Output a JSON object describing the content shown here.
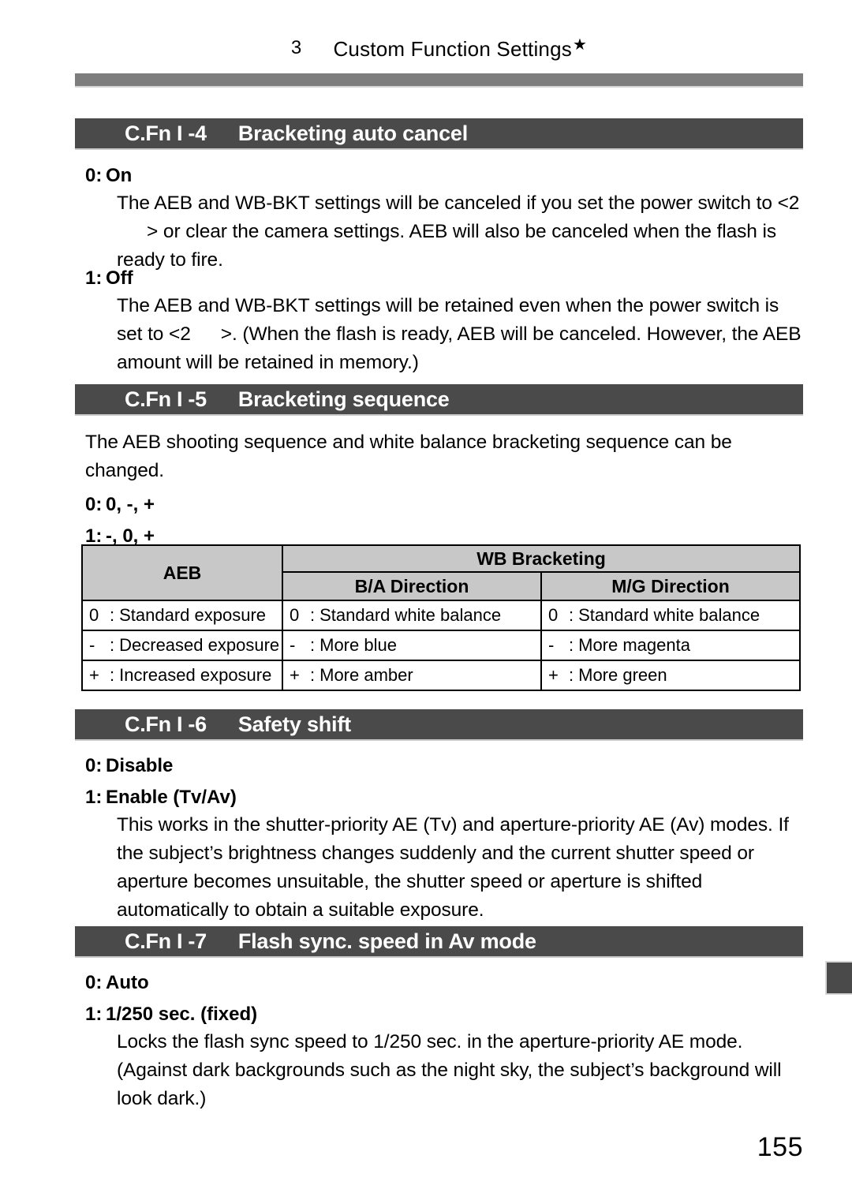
{
  "running_head": {
    "chapter_number": "3",
    "title": "Custom Function Settings",
    "marker": "★"
  },
  "sections": [
    {
      "code": "C.Fn I -4",
      "title": "Bracketing auto cancel",
      "options": [
        {
          "number": "0:",
          "label": "On"
        },
        {
          "number": "1:",
          "label": "Off"
        }
      ],
      "paragraphs": {
        "on_part1": "The AEB and WB-BKT settings will be canceled if you set the power switch to <2",
        "on_part2": "> or clear the camera settings. AEB will also be canceled when the flash is ready to fire.",
        "off_part1": "The AEB and WB-BKT settings will be retained even when the power switch is set to <2",
        "off_part2": ">. (When the flash is ready, AEB will be canceled. However, the AEB amount will be retained in memory.)"
      }
    },
    {
      "code": "C.Fn I -5",
      "title": "Bracketing sequence",
      "intro": "The AEB shooting sequence and white balance bracketing sequence can be changed.",
      "options": [
        {
          "number": "0:",
          "label": "0, -, +"
        },
        {
          "number": "1:",
          "label": "-, 0, +"
        }
      ]
    },
    {
      "code": "C.Fn I -6",
      "title": "Safety shift",
      "options": [
        {
          "number": "0:",
          "label": "Disable"
        },
        {
          "number": "1:",
          "label": "Enable (Tv/Av)"
        }
      ],
      "body": "This works in the shutter-priority AE (Tv) and aperture-priority AE (Av) modes. If the subject’s brightness changes suddenly and the current shutter speed or aperture becomes unsuitable, the shutter speed or aperture is shifted automatically to obtain a suitable exposure."
    },
    {
      "code": "C.Fn I -7",
      "title": "Flash sync. speed in Av mode",
      "options": [
        {
          "number": "0:",
          "label": "Auto"
        },
        {
          "number": "1:",
          "label": "1/250 sec. (fixed)"
        }
      ],
      "body": "Locks the flash sync speed to 1/250 sec. in the aperture-priority AE mode. (Against dark backgrounds such as the night sky, the subject’s background will look dark.)"
    }
  ],
  "bracketing_table": {
    "header_aeb": "AEB",
    "header_wb": "WB Bracketing",
    "header_ba": "B/A Direction",
    "header_mg": "M/G Direction",
    "rows": [
      {
        "aeb_sym": "0",
        "aeb_colon": ":",
        "aeb_text": "Standard exposure",
        "ba_sym": "0",
        "ba_colon": ":",
        "ba_text": "Standard white balance",
        "mg_sym": "0",
        "mg_colon": ":",
        "mg_text": "Standard white balance"
      },
      {
        "aeb_sym": "-",
        "aeb_colon": ":",
        "aeb_text": "Decreased exposure",
        "ba_sym": "-",
        "ba_colon": ":",
        "ba_text": "More blue",
        "mg_sym": "-",
        "mg_colon": ":",
        "mg_text": "More magenta"
      },
      {
        "aeb_sym": "+",
        "aeb_colon": ":",
        "aeb_text": "Increased exposure",
        "ba_sym": "+",
        "ba_colon": ":",
        "ba_text": "More amber",
        "mg_sym": "+",
        "mg_colon": ":",
        "mg_text": "More green"
      }
    ]
  },
  "folio": "155",
  "colors": {
    "rule_gray": "#7d7d7d",
    "section_bar": "#4a4a4a",
    "table_header": "#c8c8c8"
  }
}
